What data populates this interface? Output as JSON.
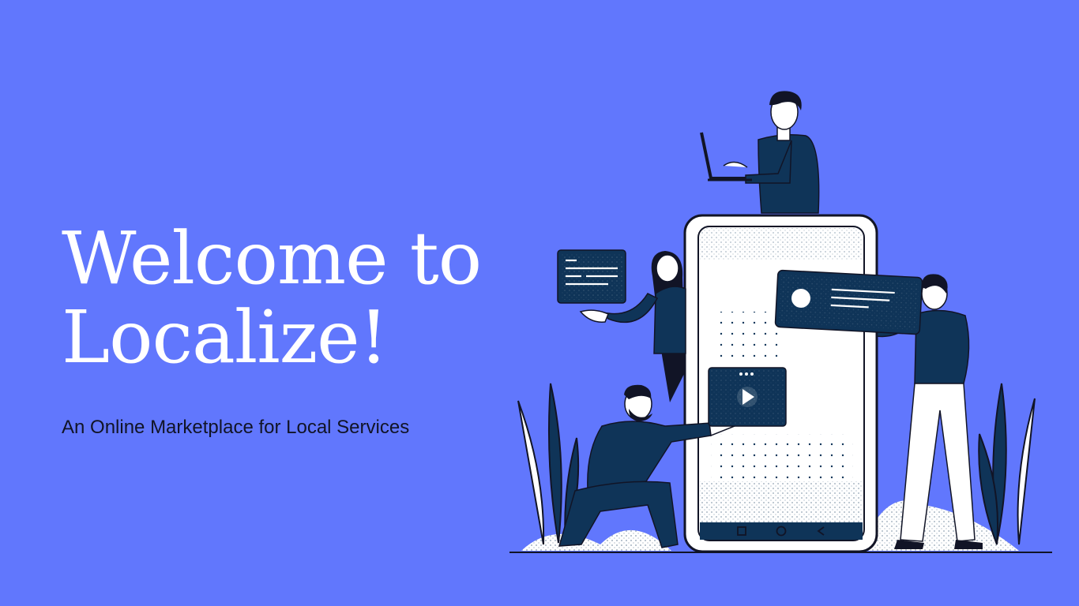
{
  "slide": {
    "title_line1": "Welcome to",
    "title_line2": "Localize!",
    "subtitle": "An Online Marketplace for Local Services"
  },
  "colors": {
    "background": "#6177fd",
    "navy": "#0f3458",
    "white": "#ffffff",
    "ink": "#111426"
  },
  "illustration": {
    "icons": [
      "laptop-icon",
      "text-card-icon",
      "profile-card-icon",
      "video-play-icon",
      "phone-nav-buttons-icon"
    ]
  }
}
